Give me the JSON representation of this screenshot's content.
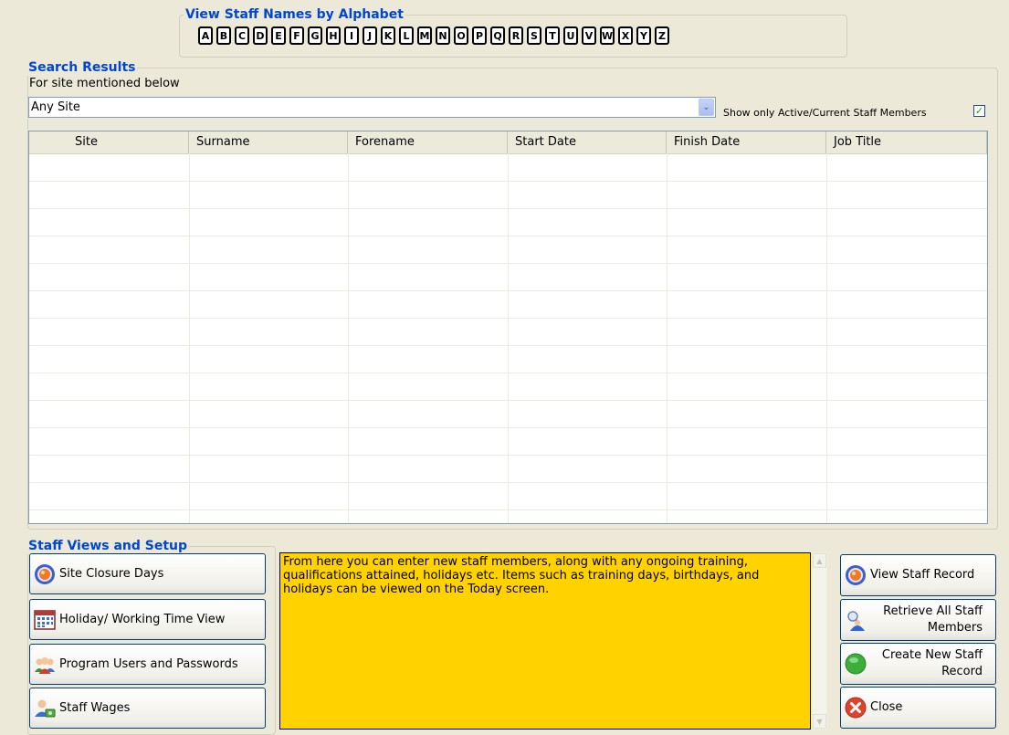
{
  "alphabet": {
    "title": "View Staff Names by Alphabet",
    "letters": [
      "A",
      "B",
      "C",
      "D",
      "E",
      "F",
      "G",
      "H",
      "I",
      "J",
      "K",
      "L",
      "M",
      "N",
      "O",
      "P",
      "Q",
      "R",
      "S",
      "T",
      "U",
      "V",
      "W",
      "X",
      "Y",
      "Z"
    ]
  },
  "search": {
    "title": "Search Results",
    "site_label": "For site mentioned below",
    "site_value": "Any Site",
    "active_only_label": "Show only Active/Current Staff Members",
    "active_only_checked": true,
    "columns": [
      "Site",
      "Surname",
      "Forename",
      "Start Date",
      "Finish Date",
      "Job Title"
    ],
    "rows": []
  },
  "staff_views": {
    "title": "Staff Views and Setup",
    "buttons": [
      {
        "label": "Site Closure Days",
        "icon": "record-icon"
      },
      {
        "label": "Holiday/ Working Time View",
        "icon": "calendar-icon"
      },
      {
        "label": "Program Users and Passwords",
        "icon": "users-icon"
      },
      {
        "label": "Staff Wages",
        "icon": "staff-wages-icon"
      }
    ]
  },
  "info": {
    "text": "From here you can enter new staff members, along with any ongoing training, qualifications attained, holidays etc. Items such as training days, birthdays, and holidays can be viewed on the Today screen."
  },
  "actions": {
    "view": "View Staff Record",
    "retrieve_line1": "Retrieve All Staff",
    "retrieve_line2": "Members",
    "create_line1": "Create New Staff",
    "create_line2": "Record",
    "close": "Close"
  },
  "colors": {
    "legend": "#0046d5",
    "info_background": "#ffd200",
    "window_background": "#ece9d8"
  }
}
